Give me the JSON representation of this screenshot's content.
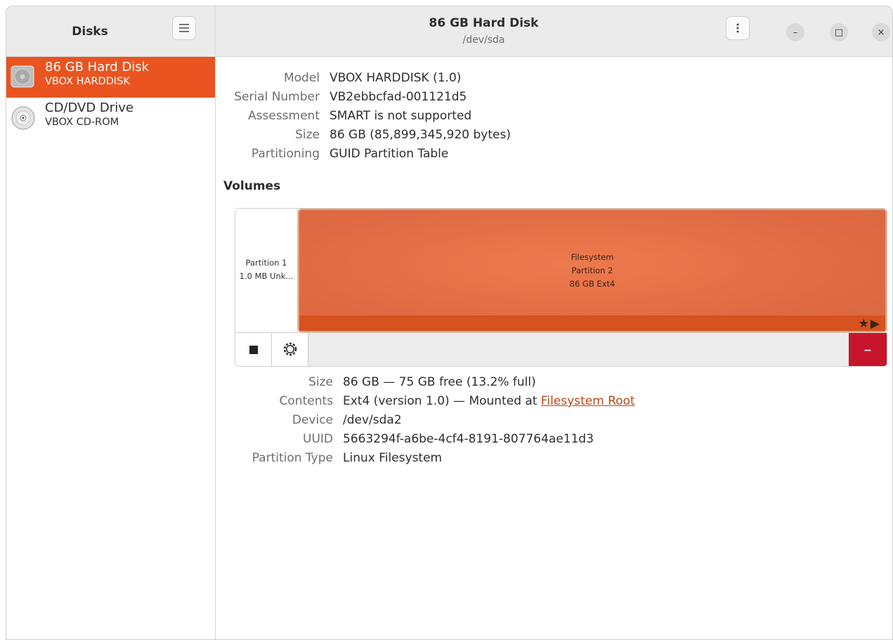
{
  "sidebar": {
    "title": "Disks",
    "menu_icon": "hamburger-menu-icon",
    "drives": [
      {
        "name": "86 GB Hard Disk",
        "model": "VBOX HARDDISK",
        "icon": "hard-disk-icon",
        "selected": true
      },
      {
        "name": "CD/DVD Drive",
        "model": "VBOX CD-ROM",
        "icon": "optical-disc-icon",
        "selected": false
      }
    ]
  },
  "header": {
    "title": "86 GB Hard Disk",
    "subtitle": "/dev/sda",
    "window_controls": {
      "minimize": "–",
      "maximize": "□",
      "close": "×"
    }
  },
  "disk_info": [
    {
      "label": "Model",
      "value": "VBOX HARDDISK (1.0)"
    },
    {
      "label": "Serial Number",
      "value": "VB2ebbcfad-001121d5"
    },
    {
      "label": "Assessment",
      "value": "SMART is not supported"
    },
    {
      "label": "Size",
      "value": "86 GB (85,899,345,920 bytes)"
    },
    {
      "label": "Partitioning",
      "value": "GUID Partition Table"
    }
  ],
  "volumes": {
    "title": "Volumes",
    "partition1": {
      "line1": "Partition 1",
      "line2": "1.0 MB Unk..."
    },
    "partition2": {
      "line1": "Filesystem",
      "line2": "Partition 2",
      "line3": "86 GB Ext4",
      "marks": "★▶"
    },
    "toolbar": {
      "delete_label": "–"
    }
  },
  "volume_info": {
    "size_label": "Size",
    "size_value": "86 GB — 75 GB free (13.2% full)",
    "contents_label": "Contents",
    "contents_value": "Ext4 (version 1.0) — Mounted at ",
    "contents_link": "Filesystem Root",
    "device_label": "Device",
    "device_value": "/dev/sda2",
    "uuid_label": "UUID",
    "uuid_value": "5663294f-a6be-4cf4-8191-807764ae11d3",
    "ptype_label": "Partition Type",
    "ptype_value": "Linux Filesystem"
  },
  "colors": {
    "accent": "#e95420",
    "destructive": "#c7162b",
    "link": "#c04516"
  }
}
